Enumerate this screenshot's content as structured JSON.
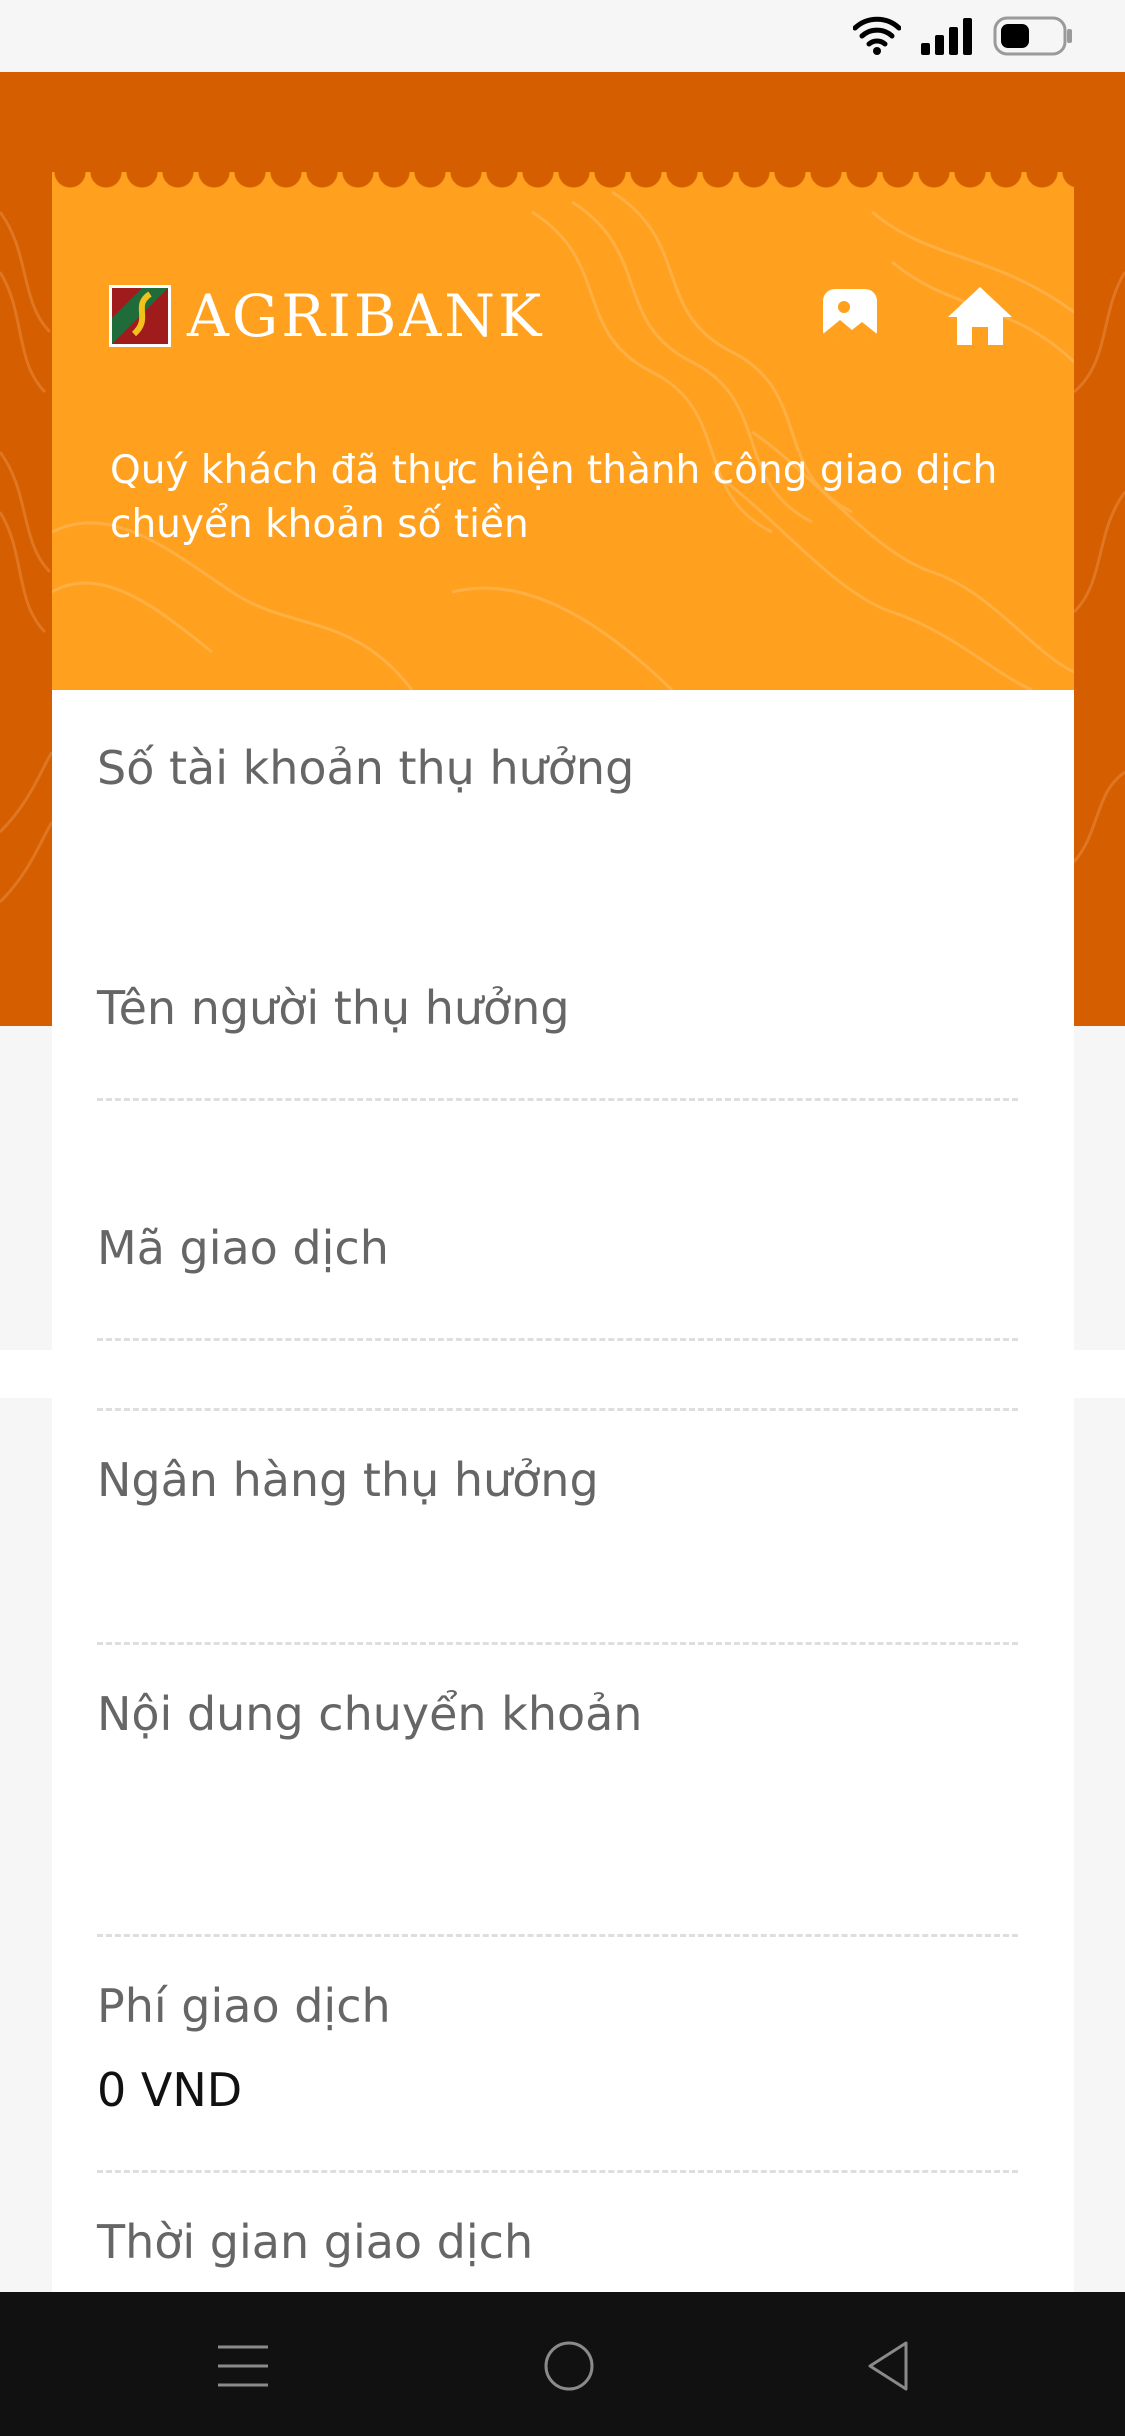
{
  "brand": {
    "name": "AGRIBANK"
  },
  "header": {
    "message": "Quý khách đã thực hiện thành công giao dịch chuyển khoản số tiền"
  },
  "fields": [
    {
      "label": "Số tài khoản thụ hưởng",
      "value": ""
    },
    {
      "label": "Tên người thụ hưởng",
      "value": ""
    },
    {
      "label": "Mã giao dịch",
      "value": ""
    },
    {
      "label": "Ngân hàng thụ hưởng",
      "value": ""
    },
    {
      "label": "Nội dung chuyển khoản",
      "value": ""
    },
    {
      "label": "Phí giao dịch",
      "value": "0 VND"
    },
    {
      "label": "Thời gian giao dịch",
      "value": ""
    }
  ],
  "colors": {
    "hero": "#d45e00",
    "header": "#ffa01e",
    "text_label": "#666666",
    "text_value": "#111111"
  },
  "icons": {
    "status": [
      "wifi-icon",
      "signal-icon",
      "battery-icon"
    ],
    "header": [
      "save-image-icon",
      "home-icon"
    ],
    "nav": [
      "menu-icon",
      "home-circle-icon",
      "back-icon"
    ]
  }
}
